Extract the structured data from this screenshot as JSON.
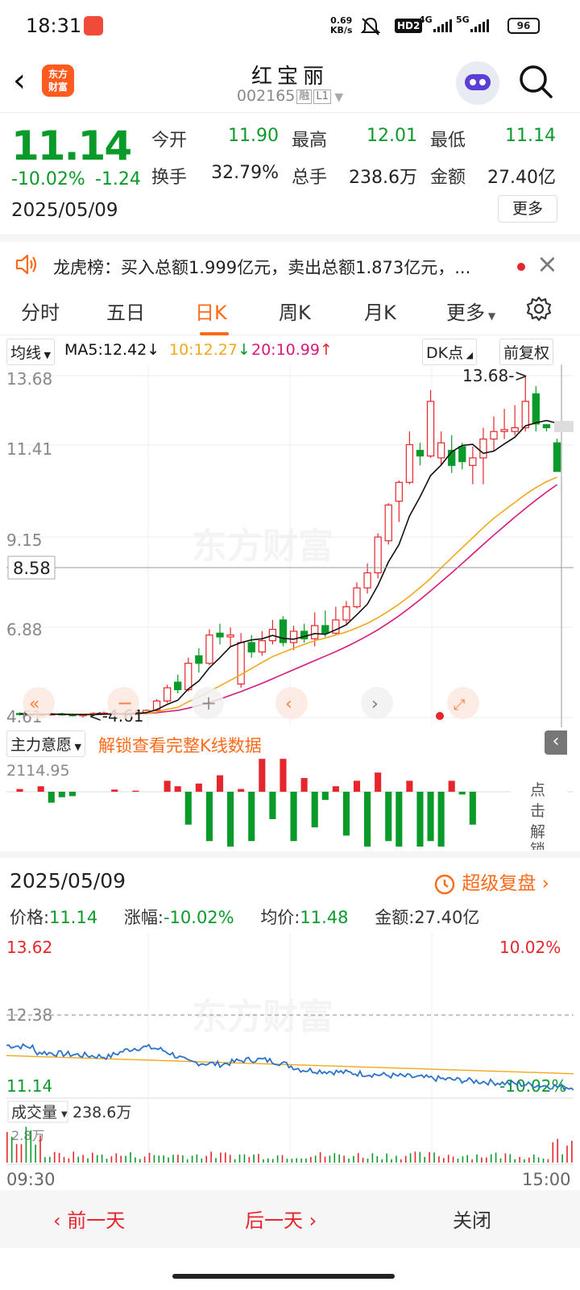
{
  "status": {
    "time": "18:31",
    "net_speed": "0.69",
    "net_unit": "KB/s",
    "hd": "HD2",
    "sig1": "4G",
    "sig2": "5G",
    "battery": "96"
  },
  "header": {
    "logo_line1": "东方",
    "logo_line2": "财富",
    "title": "红宝丽",
    "code": "002165",
    "tag1": "融",
    "tag2": "L1"
  },
  "quote": {
    "price": "11.14",
    "pct": "-10.02%",
    "chg": "-1.24",
    "date": "2025/05/09",
    "open_label": "今开",
    "open": "11.90",
    "high_label": "最高",
    "high": "12.01",
    "low_label": "最低",
    "low": "11.14",
    "turnover_label": "换手",
    "turnover": "32.79%",
    "vol_label": "总手",
    "vol": "238.6万",
    "amount_label": "金额",
    "amount": "27.40亿",
    "more": "更多"
  },
  "notice": {
    "text": "龙虎榜：买入总额1.999亿元，卖出总额1.873亿元，..."
  },
  "tabs": [
    "分时",
    "五日",
    "日K",
    "周K",
    "月K",
    "更多"
  ],
  "ma": {
    "selector": "均线",
    "ma5": "MA5:12.42",
    "ma10": "10:12.27",
    "ma20": "20:10.99",
    "dk": "DK点",
    "adjust": "前复权"
  },
  "colors": {
    "up": "#e5262c",
    "down": "#0a9a2a",
    "accent": "#ff6a1a",
    "ma5": "#111111",
    "ma10": "#f2a81d",
    "ma20": "#d6197a"
  },
  "kchart": {
    "y_labels": [
      "13.68",
      "11.41",
      "9.15",
      "6.88",
      "4.61"
    ],
    "crosshair_price": "8.58",
    "max_annot": "13.68->",
    "min_annot": "<-4.61",
    "watermark": "东方财富",
    "candles": [
      [
        4.72,
        4.7,
        4.75,
        4.66
      ],
      [
        4.7,
        4.68,
        4.73,
        4.64
      ],
      [
        4.68,
        4.7,
        4.72,
        4.65
      ],
      [
        4.7,
        4.71,
        4.74,
        4.67
      ],
      [
        4.71,
        4.69,
        4.74,
        4.66
      ],
      [
        4.69,
        4.68,
        4.72,
        4.64
      ],
      [
        4.68,
        4.69,
        4.71,
        4.61
      ],
      [
        4.69,
        4.72,
        4.75,
        4.67
      ],
      [
        4.72,
        4.73,
        4.77,
        4.7
      ],
      [
        4.73,
        4.72,
        4.76,
        4.69
      ],
      [
        4.72,
        4.7,
        4.75,
        4.68
      ],
      [
        4.7,
        4.74,
        4.78,
        4.68
      ],
      [
        4.74,
        4.8,
        4.83,
        4.72
      ],
      [
        4.8,
        5.05,
        5.1,
        4.78
      ],
      [
        5.05,
        5.4,
        5.48,
        5.0
      ],
      [
        5.55,
        5.35,
        5.75,
        5.25
      ],
      [
        5.35,
        6.05,
        6.2,
        5.3
      ],
      [
        6.25,
        6.05,
        6.45,
        5.8
      ],
      [
        6.05,
        6.8,
        6.95,
        6.0
      ],
      [
        6.85,
        6.75,
        7.1,
        6.55
      ],
      [
        6.75,
        6.8,
        7.0,
        6.5
      ],
      [
        5.5,
        6.6,
        6.85,
        5.4
      ],
      [
        6.6,
        6.35,
        6.8,
        6.2
      ],
      [
        6.35,
        6.65,
        6.9,
        6.25
      ],
      [
        6.65,
        6.95,
        7.2,
        6.55
      ],
      [
        7.2,
        6.6,
        7.3,
        6.5
      ],
      [
        6.6,
        6.9,
        7.05,
        6.4
      ],
      [
        6.9,
        6.7,
        7.1,
        6.6
      ],
      [
        6.7,
        7.05,
        7.4,
        6.5
      ],
      [
        7.05,
        6.85,
        7.45,
        6.75
      ],
      [
        6.85,
        7.2,
        7.55,
        6.8
      ],
      [
        7.2,
        7.55,
        7.7,
        7.1
      ],
      [
        7.55,
        8.05,
        8.2,
        7.5
      ],
      [
        8.05,
        8.45,
        8.7,
        7.9
      ],
      [
        8.45,
        9.4,
        9.5,
        8.3
      ],
      [
        9.3,
        10.25,
        10.3,
        9.2
      ],
      [
        10.35,
        10.85,
        10.9,
        9.8
      ],
      [
        10.85,
        11.85,
        12.2,
        10.8
      ],
      [
        11.7,
        11.55,
        11.9,
        11.3
      ],
      [
        11.55,
        13.0,
        13.3,
        11.5
      ],
      [
        11.5,
        11.9,
        12.2,
        11.3
      ],
      [
        11.7,
        11.3,
        12.1,
        11.1
      ],
      [
        11.8,
        11.4,
        11.9,
        11.2
      ],
      [
        11.3,
        11.5,
        11.8,
        10.8
      ],
      [
        11.5,
        12.0,
        12.3,
        10.8
      ],
      [
        12.0,
        12.2,
        12.6,
        11.7
      ],
      [
        12.2,
        12.25,
        12.8,
        12.0
      ],
      [
        12.2,
        12.3,
        12.9,
        12.1
      ],
      [
        12.3,
        13.0,
        13.68,
        12.2
      ],
      [
        13.2,
        12.4,
        13.4,
        12.2
      ],
      [
        12.38,
        12.3,
        12.4,
        12.2
      ],
      [
        11.9,
        11.14,
        12.01,
        11.14
      ]
    ],
    "ma5": [
      4.71,
      4.7,
      4.7,
      4.7,
      4.7,
      4.69,
      4.69,
      4.69,
      4.7,
      4.71,
      4.71,
      4.72,
      4.74,
      4.82,
      4.96,
      5.07,
      5.37,
      5.58,
      5.93,
      6.2,
      6.49,
      6.6,
      6.67,
      6.7,
      6.79,
      6.71,
      6.69,
      6.76,
      6.84,
      6.82,
      6.94,
      7.07,
      7.34,
      7.62,
      8.12,
      8.74,
      9.2,
      9.96,
      10.47,
      11.03,
      11.31,
      11.66,
      11.83,
      11.86,
      11.62,
      11.68,
      11.87,
      12.05,
      12.35,
      12.43,
      12.49,
      12.42
    ],
    "ma10": [
      4.71,
      4.7,
      4.7,
      4.7,
      4.7,
      4.7,
      4.7,
      4.7,
      4.7,
      4.7,
      4.7,
      4.71,
      4.72,
      4.76,
      4.83,
      4.88,
      5.03,
      5.15,
      5.31,
      5.45,
      5.6,
      5.75,
      5.91,
      6.07,
      6.23,
      6.34,
      6.45,
      6.55,
      6.65,
      6.72,
      6.8,
      6.88,
      6.99,
      7.11,
      7.26,
      7.43,
      7.62,
      7.83,
      8.06,
      8.3,
      8.58,
      8.85,
      9.12,
      9.38,
      9.65,
      9.9,
      10.11,
      10.32,
      10.53,
      10.71,
      10.87,
      10.99
    ],
    "ma20": [
      4.71,
      4.7,
      4.7,
      4.7,
      4.7,
      4.7,
      4.7,
      4.7,
      4.7,
      4.7,
      4.7,
      4.71,
      4.72,
      4.74,
      4.77,
      4.8,
      4.86,
      4.93,
      5.01,
      5.1,
      5.2,
      5.3,
      5.41,
      5.52,
      5.64,
      5.76,
      5.88,
      6.0,
      6.12,
      6.24,
      6.36,
      6.49,
      6.63,
      6.78,
      6.94,
      7.12,
      7.31,
      7.52,
      7.74,
      7.97,
      8.21,
      8.45,
      8.7,
      8.95,
      9.2,
      9.45,
      9.69,
      9.93,
      10.16,
      10.38,
      10.59,
      10.79
    ]
  },
  "flow": {
    "title": "主力意愿",
    "unlock": "解锁查看完整K线数据",
    "max_label": "2114.95",
    "side": [
      "点",
      "击",
      "解",
      "锁"
    ],
    "bars": [
      0.05,
      0,
      0.1,
      -0.2,
      -0.1,
      -0.08,
      0,
      0,
      0,
      0.04,
      0,
      0.02,
      0,
      0,
      0.2,
      0.1,
      -0.6,
      0.15,
      -0.9,
      0.3,
      -1.0,
      0.05,
      -0.9,
      0.6,
      -0.5,
      0.6,
      -0.9,
      0.25,
      -0.65,
      -0.15,
      0.1,
      -0.8,
      0.2,
      -1.0,
      0.35,
      -0.9,
      -1.0,
      0.2,
      -1.0,
      -0.9,
      -1.0,
      0.2,
      -0.05,
      -0.6,
      0,
      0,
      0,
      0,
      0,
      0,
      0,
      0
    ]
  },
  "detail": {
    "date": "2025/05/09",
    "replay": "超级复盘",
    "price_label": "价格:",
    "price": "11.14",
    "pct_label": "涨幅:",
    "pct": "-10.02%",
    "avg_label": "均价:",
    "avg": "11.48",
    "amount_label": "金额:",
    "amount": "27.40亿",
    "y_top": "13.62",
    "y_mid": "12.38",
    "y_bot": "11.14",
    "pct_top": "10.02%",
    "pct_bot": "-10.02%",
    "watermark": "东方财富",
    "vol_selector": "成交量",
    "vol_total": "238.6万",
    "vol_max": "2.8万",
    "t_start": "09:30",
    "t_end": "15:00"
  },
  "footer": {
    "prev": "前一天",
    "next": "后一天",
    "close": "关闭"
  }
}
